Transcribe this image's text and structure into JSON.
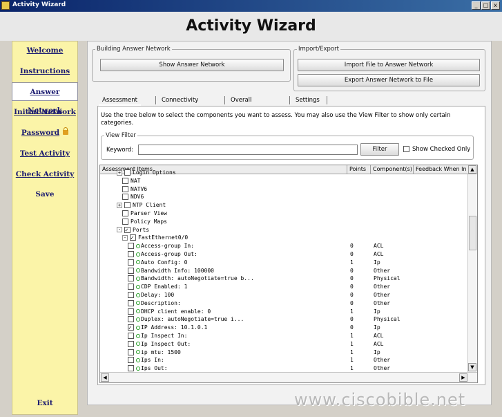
{
  "window": {
    "title": "Activity Wizard",
    "controls": [
      "_",
      "□",
      "x"
    ]
  },
  "header": {
    "title": "Activity Wizard"
  },
  "sidebar": {
    "items": [
      {
        "label": "Welcome"
      },
      {
        "label": "Instructions"
      },
      {
        "label": "Answer Network",
        "active": true
      },
      {
        "label": "Initial Network"
      },
      {
        "label": "Password",
        "icon": "lock-icon"
      },
      {
        "label": "Test Activity"
      },
      {
        "label": "Check Activity"
      },
      {
        "label": "Save"
      }
    ],
    "exit_label": "Exit"
  },
  "building_group": {
    "legend": "Building Answer Network",
    "show_button": "Show Answer Network"
  },
  "import_group": {
    "legend": "Import/Export",
    "import_button": "Import File to Answer Network",
    "export_button": "Export Answer Network to File"
  },
  "tabs": [
    "Assessment Tree",
    "Connectivity Test",
    "Overall Feedback",
    "Settings"
  ],
  "description": "Use the tree below to select the components you want to assess. You may also use the View Filter to show only certain categories.",
  "view_filter": {
    "legend": "View Filter",
    "keyword_label": "Keyword:",
    "keyword_value": "",
    "filter_button": "Filter",
    "show_checked_label": "Show Checked Only",
    "show_checked": false
  },
  "grid": {
    "columns": [
      "Assessment Items",
      "Points",
      "Component(s)",
      "Feedback When In"
    ],
    "rows": [
      {
        "label": "Login Options",
        "indent": 2,
        "expander": "+",
        "checked": false,
        "points": "",
        "component": ""
      },
      {
        "label": "NAT",
        "indent": 3,
        "expander": "",
        "checked": false,
        "points": "",
        "component": ""
      },
      {
        "label": "NATV6",
        "indent": 3,
        "expander": "",
        "checked": false,
        "points": "",
        "component": ""
      },
      {
        "label": "NDV6",
        "indent": 3,
        "expander": "",
        "checked": false,
        "points": "",
        "component": ""
      },
      {
        "label": "NTP Client",
        "indent": 2,
        "expander": "+",
        "checked": false,
        "points": "",
        "component": ""
      },
      {
        "label": "Parser View",
        "indent": 3,
        "expander": "",
        "checked": false,
        "points": "",
        "component": ""
      },
      {
        "label": "Policy Maps",
        "indent": 3,
        "expander": "",
        "checked": false,
        "points": "",
        "component": ""
      },
      {
        "label": "Ports",
        "indent": 2,
        "expander": "-",
        "checked": true,
        "points": "",
        "component": ""
      },
      {
        "label": "FastEthernet0/0",
        "indent": 3,
        "expander": "-",
        "checked": true,
        "points": "",
        "component": ""
      },
      {
        "label": "Access-group In:",
        "indent": 4,
        "dot": true,
        "checked": false,
        "points": "0",
        "component": "ACL"
      },
      {
        "label": "Access-group Out:",
        "indent": 4,
        "dot": true,
        "checked": false,
        "points": "0",
        "component": "ACL"
      },
      {
        "label": "Auto Config: 0",
        "indent": 4,
        "dot": true,
        "checked": false,
        "points": "1",
        "component": "Ip"
      },
      {
        "label": "Bandwidth Info: 100000",
        "indent": 4,
        "dot": true,
        "checked": false,
        "points": "0",
        "component": "Other"
      },
      {
        "label": "Bandwidth: autoNegotiate=true b...",
        "indent": 4,
        "dot": true,
        "checked": false,
        "points": "0",
        "component": "Physical"
      },
      {
        "label": "CDP Enabled: 1",
        "indent": 4,
        "dot": true,
        "checked": false,
        "points": "0",
        "component": "Other"
      },
      {
        "label": "Delay: 100",
        "indent": 4,
        "dot": true,
        "checked": false,
        "points": "0",
        "component": "Other"
      },
      {
        "label": "Description:",
        "indent": 4,
        "dot": true,
        "checked": false,
        "points": "0",
        "component": "Other"
      },
      {
        "label": "DHCP client enable: 0",
        "indent": 4,
        "dot": true,
        "checked": false,
        "points": "1",
        "component": "Ip"
      },
      {
        "label": "Duplex: autoNegotiate=true i...",
        "indent": 4,
        "dot": true,
        "checked": false,
        "points": "0",
        "component": "Physical"
      },
      {
        "label": "IP Address: 10.1.0.1",
        "indent": 4,
        "dot": true,
        "checked": true,
        "points": "0",
        "component": "Ip"
      },
      {
        "label": "Ip Inspect In:",
        "indent": 4,
        "dot": true,
        "checked": false,
        "points": "1",
        "component": "ACL"
      },
      {
        "label": "Ip Inspect Out:",
        "indent": 4,
        "dot": true,
        "checked": false,
        "points": "1",
        "component": "ACL"
      },
      {
        "label": "ip mtu: 1500",
        "indent": 4,
        "dot": true,
        "checked": false,
        "points": "1",
        "component": "Ip"
      },
      {
        "label": "Ips In:",
        "indent": 4,
        "dot": true,
        "checked": false,
        "points": "1",
        "component": "Other"
      },
      {
        "label": "Ips Out:",
        "indent": 4,
        "dot": true,
        "checked": false,
        "points": "1",
        "component": "Other"
      }
    ]
  },
  "watermark": "www.ciscobible.net"
}
